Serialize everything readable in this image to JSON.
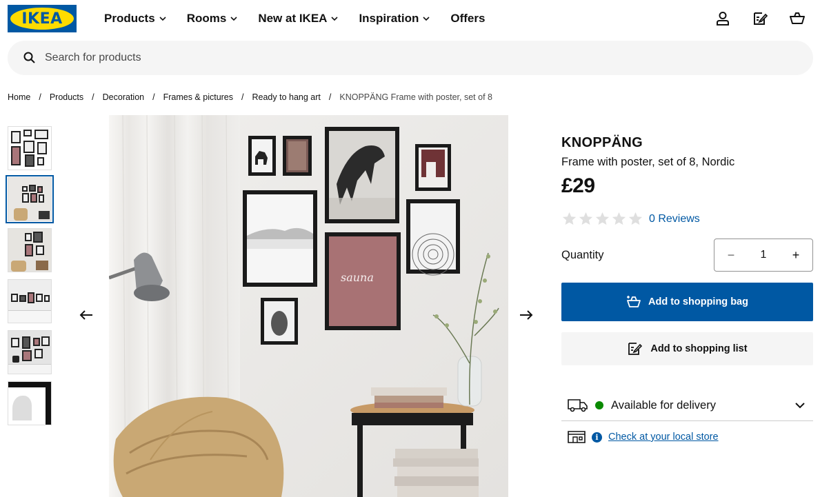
{
  "header": {
    "logo_text": "IKEA",
    "nav": [
      {
        "label": "Products",
        "has_dropdown": true
      },
      {
        "label": "Rooms",
        "has_dropdown": true
      },
      {
        "label": "New at IKEA",
        "has_dropdown": true
      },
      {
        "label": "Inspiration",
        "has_dropdown": true
      },
      {
        "label": "Offers",
        "has_dropdown": false
      }
    ],
    "icons": [
      "user-icon",
      "shopping-list-icon",
      "shopping-bag-icon"
    ]
  },
  "search": {
    "placeholder": "Search for products",
    "icon": "search-icon"
  },
  "breadcrumb": [
    "Home",
    "Products",
    "Decoration",
    "Frames & pictures",
    "Ready to hang art",
    "KNOPPÄNG Frame with poster, set of 8"
  ],
  "gallery": {
    "thumbnail_count": 6,
    "active_thumbnail": 2,
    "poster_text": "sauna",
    "prev_icon": "arrow-left-icon",
    "next_icon": "arrow-right-icon"
  },
  "product": {
    "name": "KNOPPÄNG",
    "description": "Frame with poster, set of 8, Nordic",
    "price": "£29",
    "rating": 0,
    "reviews_label": "0 Reviews"
  },
  "quantity": {
    "label": "Quantity",
    "value": "1",
    "minus": "−",
    "plus": "+"
  },
  "actions": {
    "add_to_bag": "Add to shopping bag",
    "add_to_list": "Add to shopping list"
  },
  "availability": {
    "delivery_label": "Available for delivery",
    "delivery_status_color": "#0a8a00",
    "store_link": "Check at your local store",
    "info_glyph": "i"
  },
  "colors": {
    "brand_blue": "#0058a3",
    "brand_yellow": "#ffdb00"
  }
}
